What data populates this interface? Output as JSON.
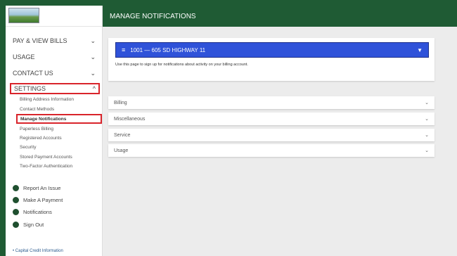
{
  "header": {
    "title": "MANAGE NOTIFICATIONS"
  },
  "sidebar": {
    "groups": [
      {
        "label": "PAY & VIEW BILLS",
        "chevron": "⌄"
      },
      {
        "label": "USAGE",
        "chevron": "⌄"
      },
      {
        "label": "CONTACT US",
        "chevron": "⌄"
      }
    ],
    "settings": {
      "label": "SETTINGS",
      "chevron": "^"
    },
    "settings_items": [
      "Billing Address Information",
      "Contact Methods",
      "Manage Notifications",
      "Paperless Billing",
      "Registered Accounts",
      "Security",
      "Stored Payment Accounts",
      "Two-Factor Authentication"
    ],
    "actions": [
      "Report An Issue",
      "Make A Payment",
      "Notifications",
      "Sign Out"
    ],
    "footer_link": "• Capital Credit Information"
  },
  "main": {
    "account": "1001 — 605 SD HIGHWAY 11",
    "note": "Use this page to sign up for notifications about activity on your billing account.",
    "sections": [
      "Billing",
      "Miscellaneous",
      "Service",
      "Usage"
    ]
  },
  "colors": {
    "header": "#1f5b34",
    "select": "#2f52d9",
    "highlight": "#d9242b"
  }
}
